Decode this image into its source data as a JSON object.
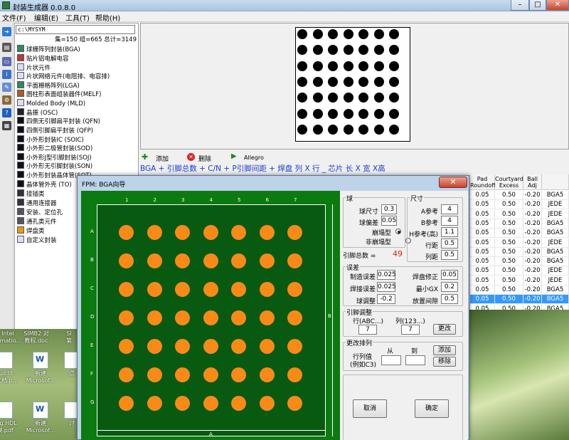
{
  "main": {
    "title": "封装生成器 0.0.8.0",
    "menu": [
      "文件(F)",
      "编辑(E)",
      "工具(T)",
      "帮助(H)"
    ],
    "path": "c:\\MYSYM",
    "stats": "集=150 组=665 总计=3149",
    "tree": [
      "球栅阵列封装(BGA)",
      "贴片铝电解电容",
      "片状元件",
      "片状网络元件(电阻排、电容排)",
      "平面栅格阵列(LGA)",
      "圆柱形表面组装器件(MELF)",
      "Molded Body (MLD)",
      "晶振 (OSC)",
      "四侧无引脚扁平封装 (QFN)",
      "四侧引脚扁平封装 (QFP)",
      "小外形封装IC (SOIC)",
      "小外形二极管封装(SOD)",
      "小外形J型引脚封装(SOJ)",
      "小外形无引脚封装(SON)",
      "小外形封装晶体管(SOT)",
      "晶体管外壳 (TO)",
      "接插类",
      "通用连接器",
      "安装、定位孔",
      "通孔类元件",
      "焊盘类",
      "自定义封装"
    ],
    "actions": [
      "添加",
      "删除",
      "Allegro"
    ],
    "formula": "BGA + 引脚总数 + C/N + P引脚间距 + 焊盘 列 X 行 _ 芯片 长 X 宽 X高",
    "grid": {
      "headers": [
        "Pad Roundoff",
        "Courtyard Excess",
        "Ball Adj"
      ],
      "rows": [
        [
          "0.05",
          "0.50",
          "-0.20",
          "BGA5"
        ],
        [
          "0.05",
          "0.50",
          "-0.20",
          "JEDE"
        ],
        [
          "0.05",
          "0.50",
          "-0.20",
          "JEDE"
        ],
        [
          "0.05",
          "0.50",
          "-0.20",
          "BGA5"
        ],
        [
          "0.05",
          "0.50",
          "-0.20",
          "BGA5"
        ],
        [
          "0.05",
          "0.50",
          "-0.20",
          "JEDE"
        ],
        [
          "0.05",
          "0.50",
          "-0.20",
          "BGA5"
        ],
        [
          "0.05",
          "0.50",
          "-0.20",
          "BGA5"
        ],
        [
          "0.05",
          "0.50",
          "-0.20",
          "JEDE"
        ],
        [
          "0.05",
          "0.50",
          "-0.20",
          "JEDE"
        ],
        [
          "0.05",
          "0.50",
          "-0.20",
          "BGA5"
        ],
        [
          "0.05",
          "0.50",
          "-0.20",
          "BGA5"
        ],
        [
          "0.05",
          "0.50",
          "-0.20",
          "BGA5"
        ]
      ]
    }
  },
  "desktop": {
    "icons": [
      "Intel",
      "SIMB2 对",
      "SI",
      "ormatio...",
      "教程.doc",
      "第",
      "tus.lit",
      "新建",
      "点",
      "ri文档.p...",
      "Microsof...",
      "Log.HDL",
      "新建",
      "讨",
      "模.pdf",
      "Microsof..."
    ]
  },
  "dialog": {
    "title": "FPM: BGA向导",
    "cols": [
      "1",
      "2",
      "3",
      "4",
      "5",
      "6",
      "7"
    ],
    "rows": [
      "A",
      "B",
      "C",
      "D",
      "E",
      "F",
      "G"
    ],
    "dim_a": "A",
    "dim_b": "B",
    "ball": {
      "group": "球",
      "size_label": "球尺寸",
      "size": "0.3",
      "tol_label": "球偏差",
      "tol": "0.05",
      "collapse_label": "崩塌型",
      "noncollapse_label": "非崩塌型"
    },
    "dims": {
      "group": "尺寸",
      "a_label": "A参考",
      "a": "4",
      "b_label": "B参考",
      "b": "4",
      "h_label": "H参考(高)",
      "h": "1.1",
      "row_pitch_label": "行距",
      "row_pitch": "0.5",
      "col_pitch_label": "列距",
      "col_pitch": "0.5"
    },
    "pin_total_label": "引脚总数 =",
    "pin_total": "49",
    "tol": {
      "group": "误差",
      "mfg_label": "制造误差",
      "mfg": "0.025",
      "pad_fix_label": "焊盘修正",
      "pad_fix": "0.05",
      "weld_label": "焊接误差",
      "weld": "0.025",
      "min_gx_label": "最小GX",
      "min_gx": "0.2",
      "ball_adj_label": "球调整",
      "ball_adj": "-0.2",
      "place_label": "放置间隙",
      "place": "0.5"
    },
    "pinadj": {
      "group": "引脚调整",
      "row_label": "行(ABC...)",
      "row": "7",
      "col_label": "列(123...)",
      "col": "7",
      "change": "更改"
    },
    "reorder": {
      "group": "更改排列",
      "from_label": "从",
      "to_label": "到",
      "value_label": "行列值",
      "value_hint": "(例如C3)",
      "from": "",
      "to": "",
      "add": "添加",
      "remove": "移除"
    },
    "cancel": "取消",
    "ok": "确定"
  }
}
